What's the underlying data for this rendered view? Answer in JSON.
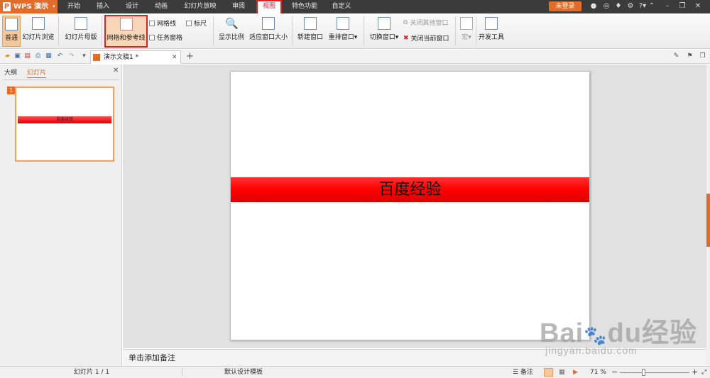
{
  "app": {
    "logo_label": "WPS 演示",
    "login_label": "未登录"
  },
  "menu_tabs": [
    "开始",
    "插入",
    "设计",
    "动画",
    "幻灯片放映",
    "审阅",
    "视图",
    "特色功能",
    "自定义"
  ],
  "ribbon": {
    "normal": "普通",
    "slide_browse": "幻灯片浏览",
    "slide_master": "幻灯片母版",
    "grid_guides": "网格和参考线",
    "gridlines": "网格线",
    "ruler": "标尺",
    "task_pane": "任务窗格",
    "zoom_ratio": "显示比例",
    "fit_window": "适应窗口大小",
    "new_window": "新建窗口",
    "arrange_window": "重排窗口",
    "switch_window": "切换窗口",
    "close_other": "关闭其他窗口",
    "close_current": "关闭当前窗口",
    "macro": "宏",
    "dev_tools": "开发工具"
  },
  "document": {
    "tab_title": "演示文稿1 *"
  },
  "left_pane": {
    "tab_outline": "大纲",
    "tab_slides": "幻灯片",
    "thumb_number": "1",
    "thumb_title": "百度经验"
  },
  "slide": {
    "title": "百度经验"
  },
  "notes_placeholder": "单击添加备注",
  "status": {
    "slide_count": "幻灯片 1 / 1",
    "template": "默认设计模板",
    "notes_label": "备注",
    "zoom": "71 %"
  },
  "watermark": {
    "brand": "Bai",
    "brand2": "du",
    "cn": "经验",
    "url": "jingyan.baidu.com"
  },
  "colors": {
    "accent": "#e46c2a",
    "slide_band": "#ff0000",
    "highlight_box": "#e02020"
  }
}
